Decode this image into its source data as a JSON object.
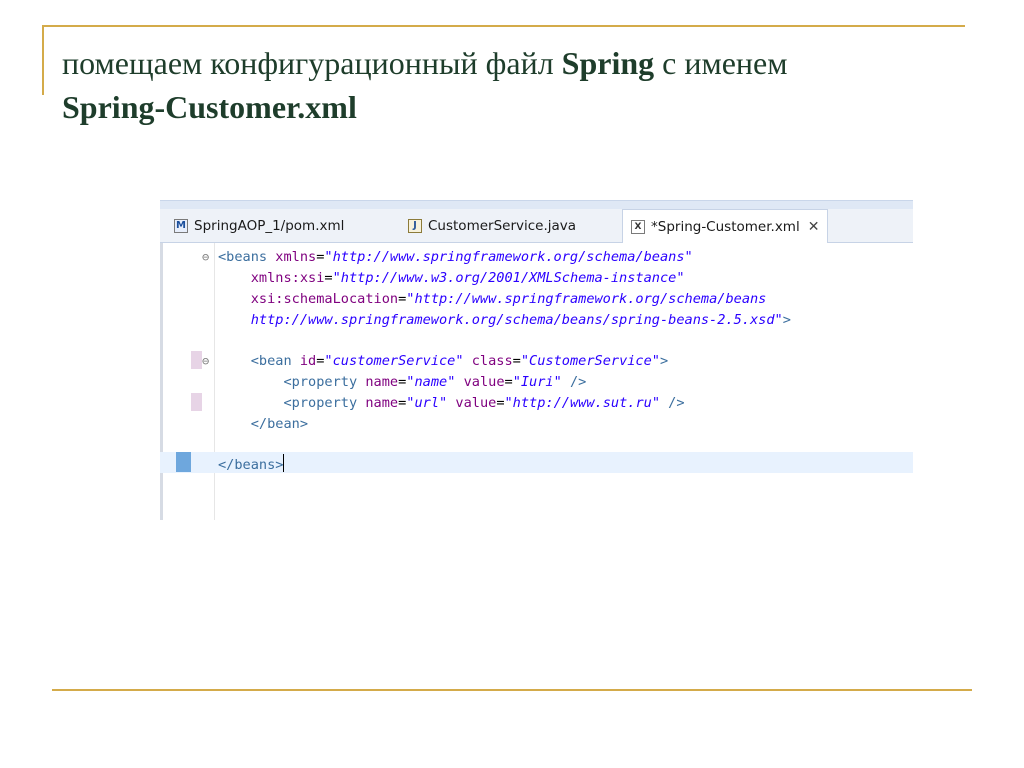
{
  "slide": {
    "title_part1": "помещаем конфигурационный файл ",
    "title_bold1": "Spring",
    "title_part2": " с именем ",
    "title_bold2": "Spring-Customer.xml"
  },
  "editor": {
    "tabs": [
      {
        "icon": "maven-pom-icon",
        "icon_glyph": "M",
        "label": "SpringAOP_1/pom.xml"
      },
      {
        "icon": "java-file-icon",
        "icon_glyph": "J",
        "label": "CustomerService.java"
      },
      {
        "icon": "xml-file-icon",
        "icon_glyph": "X",
        "label": "*Spring-Customer.xml",
        "active": true,
        "close_glyph": "✕"
      }
    ],
    "fold_glyph": "⊖",
    "code": {
      "l1": {
        "open": "<beans",
        "attr": "xmlns",
        "eq": "=",
        "val": "\"http://www.springframework.org/schema/beans\""
      },
      "l2": {
        "indent": "    ",
        "attr": "xmlns:xsi",
        "eq": "=",
        "val": "\"http://www.w3.org/2001/XMLSchema-instance\""
      },
      "l3": {
        "indent": "    ",
        "attr": "xsi:schemaLocation",
        "eq": "=",
        "val": "\"http://www.springframework.org/schema/beans"
      },
      "l4": {
        "indent": "    ",
        "val": "http://www.springframework.org/schema/beans/spring-beans-2.5.xsd\"",
        "close": ">"
      },
      "l6": {
        "indent": "    ",
        "open": "<bean",
        "a1": "id",
        "eq": "=",
        "v1": "\"customerService\"",
        "a2": "class",
        "v2": "\"CustomerService\"",
        "close": ">"
      },
      "l7": {
        "indent": "        ",
        "open": "<property",
        "a1": "name",
        "eq": "=",
        "v1": "\"name\"",
        "a2": "value",
        "v2": "\"Iuri\"",
        "close": " />"
      },
      "l8": {
        "indent": "        ",
        "open": "<property",
        "a1": "name",
        "eq": "=",
        "v1": "\"url\"",
        "a2": "value",
        "v2": "\"http://www.sut.ru\"",
        "close": " />"
      },
      "l9": {
        "indent": "    ",
        "text": "</bean>"
      },
      "l11": {
        "text": "</beans>"
      }
    }
  }
}
